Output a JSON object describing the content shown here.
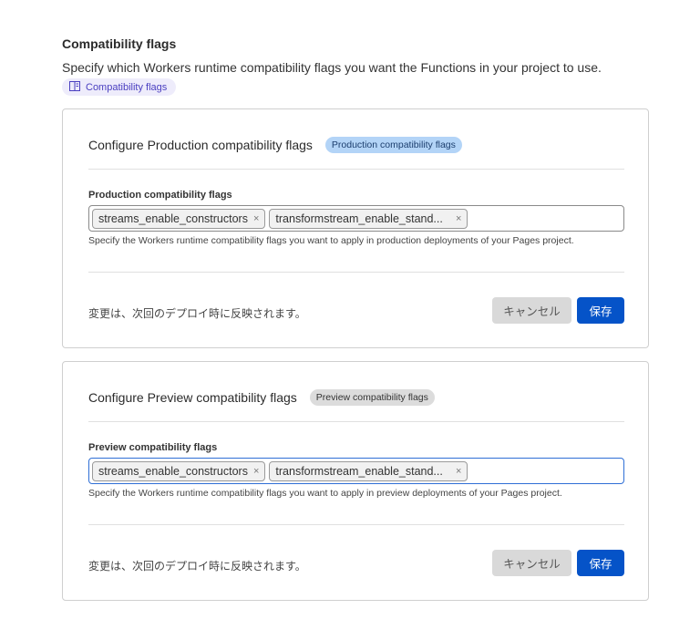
{
  "section": {
    "title": "Compatibility flags",
    "description": "Specify which Workers runtime compatibility flags you want the Functions in your project to use.",
    "doc_link": "Compatibility flags"
  },
  "cards": [
    {
      "title": "Configure Production compatibility flags",
      "badge": "Production compatibility flags",
      "label": "Production compatibility flags",
      "tags": [
        "streams_enable_constructors",
        "transformstream_enable_stand..."
      ],
      "help": "Specify the Workers runtime compatibility flags you want to apply in production deployments of your Pages project.",
      "footer_note": "変更は、次回のデプロイ時に反映されます。",
      "cancel": "キャンセル",
      "save": "保存"
    },
    {
      "title": "Configure Preview compatibility flags",
      "badge": "Preview compatibility flags",
      "label": "Preview compatibility flags",
      "tags": [
        "streams_enable_constructors",
        "transformstream_enable_stand..."
      ],
      "help": "Specify the Workers runtime compatibility flags you want to apply in preview deployments of your Pages project.",
      "footer_note": "変更は、次回のデプロイ時に反映されます。",
      "cancel": "キャンセル",
      "save": "保存"
    }
  ],
  "remove_glyph": "×"
}
